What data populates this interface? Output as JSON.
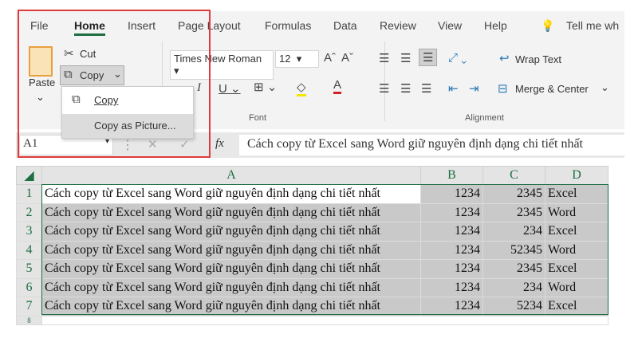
{
  "tabs": [
    "File",
    "Home",
    "Insert",
    "Page Layout",
    "Formulas",
    "Data",
    "Review",
    "View",
    "Help"
  ],
  "tell_me": "Tell me wh",
  "clipboard": {
    "paste": "Paste",
    "cut": "Cut",
    "copy": "Copy"
  },
  "copy_menu": [
    "Copy",
    "Copy as Picture..."
  ],
  "font": {
    "name": "Times New Roman",
    "size": "12",
    "group": "Font"
  },
  "alignment": {
    "wrap": "Wrap Text",
    "merge": "Merge & Center",
    "group": "Alignment"
  },
  "formula_bar": {
    "name_box": "A1",
    "fx": "fx",
    "content": "Cách copy từ Excel sang Word giữ nguyên định dạng chi tiết nhất"
  },
  "columns": [
    "A",
    "B",
    "C",
    "D"
  ],
  "rows": [
    {
      "n": "1",
      "a": "Cách copy từ Excel sang Word giữ nguyên định dạng chi tiết nhất",
      "b": "1234",
      "c": "2345",
      "d": "Excel"
    },
    {
      "n": "2",
      "a": "Cách copy từ Excel sang Word giữ nguyên định dạng chi tiết nhất",
      "b": "1234",
      "c": "2345",
      "d": "Word"
    },
    {
      "n": "3",
      "a": "Cách copy từ Excel sang Word giữ nguyên định dạng chi tiết nhất",
      "b": "1234",
      "c": "234",
      "d": "Excel"
    },
    {
      "n": "4",
      "a": "Cách copy từ Excel sang Word giữ nguyên định dạng chi tiết nhất",
      "b": "1234",
      "c": "52345",
      "d": "Word"
    },
    {
      "n": "5",
      "a": "Cách copy từ Excel sang Word giữ nguyên định dạng chi tiết nhất",
      "b": "1234",
      "c": "2345",
      "d": "Excel"
    },
    {
      "n": "6",
      "a": "Cách copy từ Excel sang Word giữ nguyên định dạng chi tiết nhất",
      "b": "1234",
      "c": "234",
      "d": "Word"
    },
    {
      "n": "7",
      "a": "Cách copy từ Excel sang Word giữ nguyên định dạng chi tiết nhất",
      "b": "1234",
      "c": "5234",
      "d": "Excel"
    }
  ],
  "row8": "8"
}
